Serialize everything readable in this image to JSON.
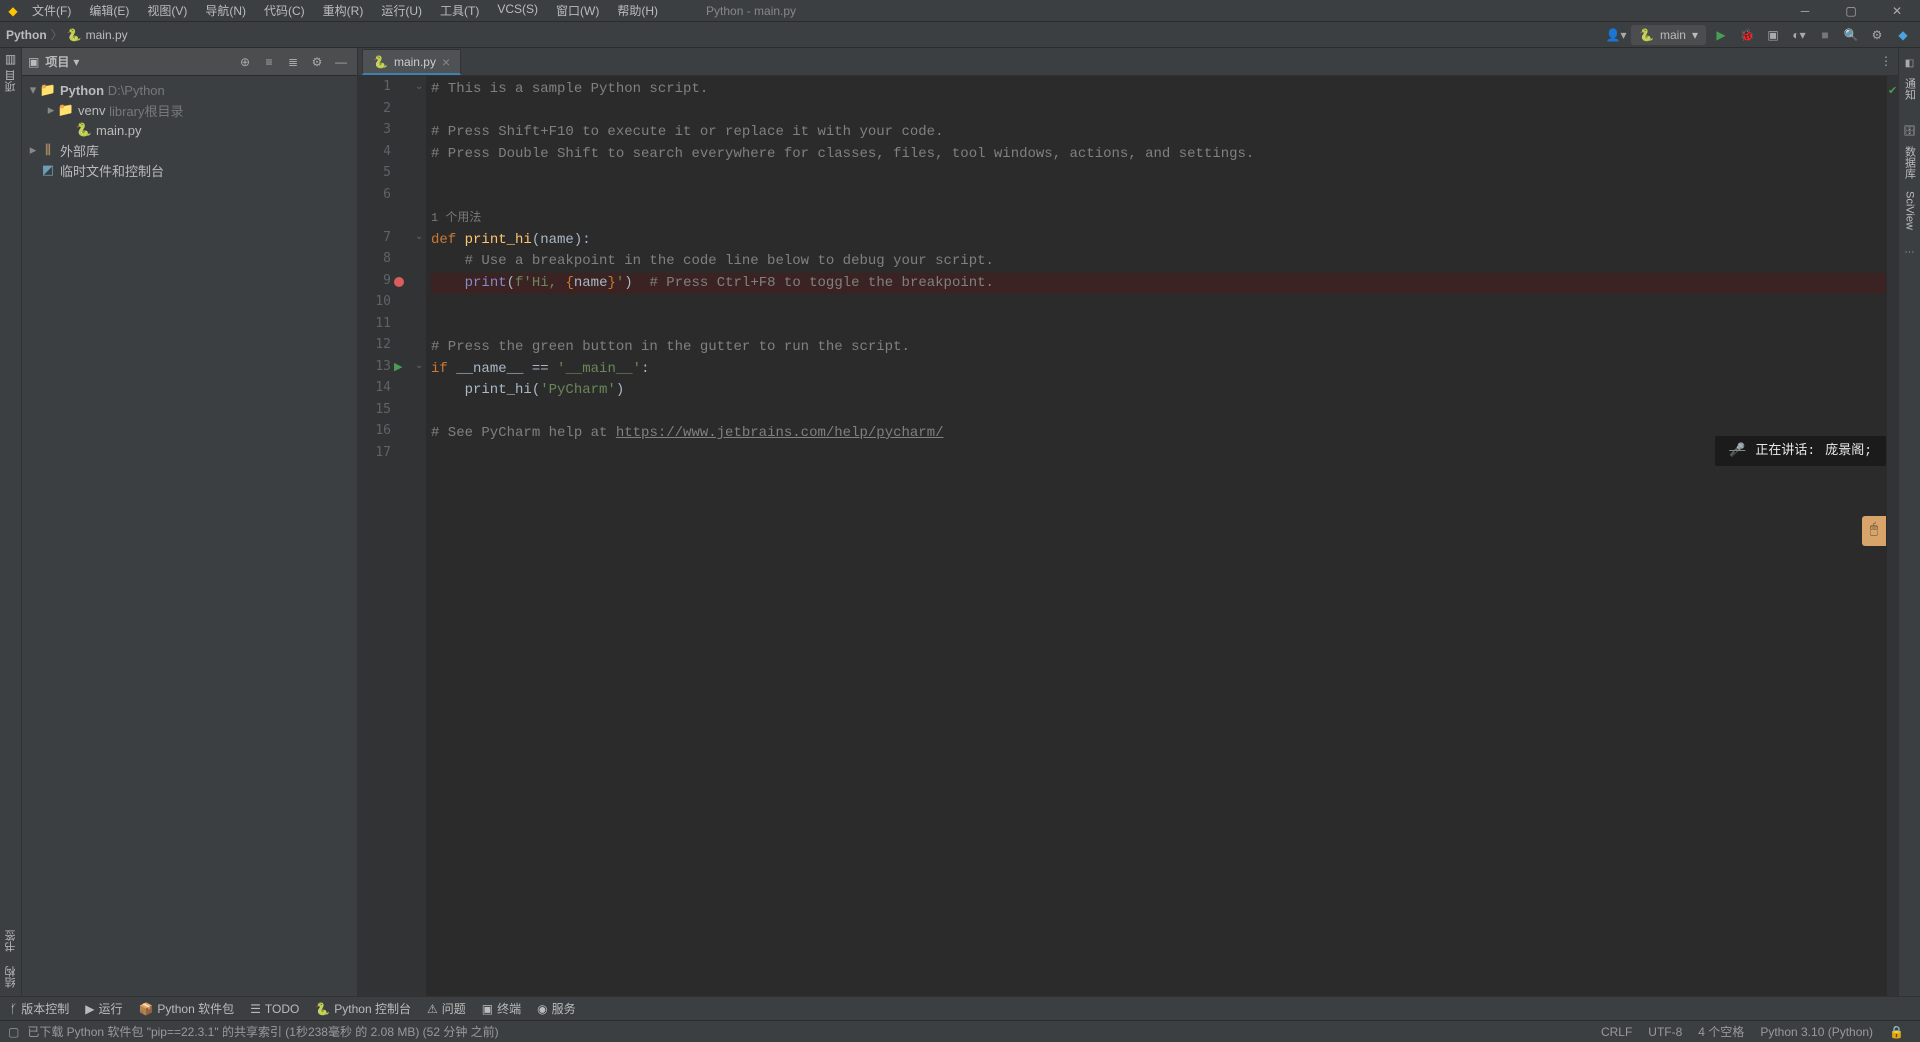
{
  "window": {
    "title": "Python - main.py"
  },
  "menu": [
    "文件(F)",
    "编辑(E)",
    "视图(V)",
    "导航(N)",
    "代码(C)",
    "重构(R)",
    "运行(U)",
    "工具(T)",
    "VCS(S)",
    "窗口(W)",
    "帮助(H)"
  ],
  "breadcrumb": {
    "project": "Python",
    "file": "main.py"
  },
  "runconfig": {
    "name": "main"
  },
  "project_panel": {
    "title": "项目",
    "tree": {
      "root": {
        "name": "Python",
        "path": "D:\\Python"
      },
      "venv": {
        "name": "venv",
        "note": "library根目录"
      },
      "file": "main.py",
      "ext_lib": "外部库",
      "scratch": "临时文件和控制台"
    }
  },
  "tab": {
    "name": "main.py"
  },
  "code_lines": [
    "# This is a sample Python script.",
    "",
    "# Press Shift+F10 to execute it or replace it with your code.",
    "# Press Double Shift to search everywhere for classes, files, tool windows, actions, and settings.",
    "",
    "",
    "def print_hi(name):",
    "    # Use a breakpoint in the code line below to debug your script.",
    "    print(f'Hi, {name}')  # Press Ctrl+F8 to toggle the breakpoint.",
    "",
    "",
    "# Press the green button in the gutter to run the script.",
    "if __name__ == '__main__':",
    "    print_hi('PyCharm')",
    "",
    "# See PyCharm help at https://www.jetbrains.com/help/pycharm/",
    ""
  ],
  "usages_hint": "1 个用法",
  "line_numbers": [
    1,
    2,
    3,
    4,
    5,
    6,
    7,
    8,
    9,
    10,
    11,
    12,
    13,
    14,
    15,
    16,
    17
  ],
  "left_sidebar": {
    "top": "项目",
    "bottom": [
      "书签",
      "结构"
    ]
  },
  "right_sidebar": {
    "items": [
      "通知",
      "数据库",
      "SciView",
      "..."
    ]
  },
  "speaking": {
    "label": "正在讲话:",
    "name": "庞景阁;"
  },
  "bottom_tools": [
    "版本控制",
    "运行",
    "Python 软件包",
    "TODO",
    "Python 控制台",
    "问题",
    "终端",
    "服务"
  ],
  "status": {
    "message": "已下载 Python 软件包 \"pip==22.3.1\" 的共享索引 (1秒238毫秒 的 2.08 MB) (52 分钟 之前)",
    "line_sep": "CRLF",
    "encoding": "UTF-8",
    "indent": "4 个空格",
    "interpreter": "Python 3.10 (Python)"
  }
}
